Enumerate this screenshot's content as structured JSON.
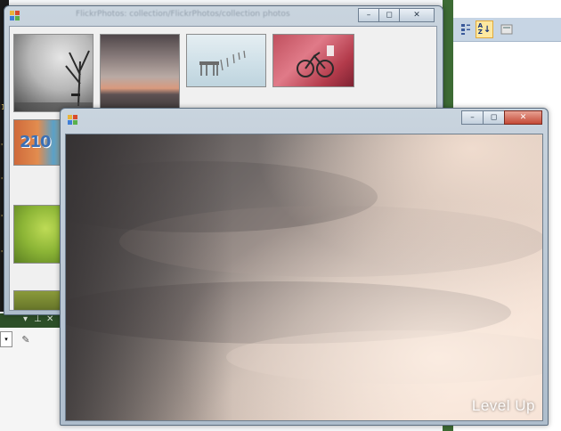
{
  "background": {
    "sort_toolbar": {
      "categorized_icon": "categorized-icon",
      "alpha_label": "A\nZ",
      "pages_icon": "property-pages-icon"
    },
    "left_panel": {
      "pin_icon": "pin-icon",
      "close_icon": "close-icon",
      "gutter_marks": [
        "'",
        "1",
        "'",
        "'",
        "'"
      ]
    }
  },
  "gallery_window": {
    "title": "FlickrPhotos: collection/FlickrPhotos/collection photos",
    "minimize": "–",
    "maximize": "◻",
    "close": "✕",
    "thumbnails": [
      {
        "subject": "foggy-park-bench"
      },
      {
        "subject": "cloudy-city-sunset"
      },
      {
        "subject": "pier-in-lake"
      },
      {
        "subject": "red-room-bicycle"
      },
      {
        "subject": "graffiti-wall"
      },
      {
        "subject": "green-foliage"
      },
      {
        "subject": "wood-chair"
      }
    ]
  },
  "viewer_window": {
    "minimize": "–",
    "maximize": "◻",
    "close": "✕",
    "image_subject": "cloudy-sky",
    "watermark": "Level Up"
  },
  "colors": {
    "ide_green": "#3d6b34",
    "toolbar_blue": "#c7d5e4",
    "close_red": "#c44a36"
  }
}
